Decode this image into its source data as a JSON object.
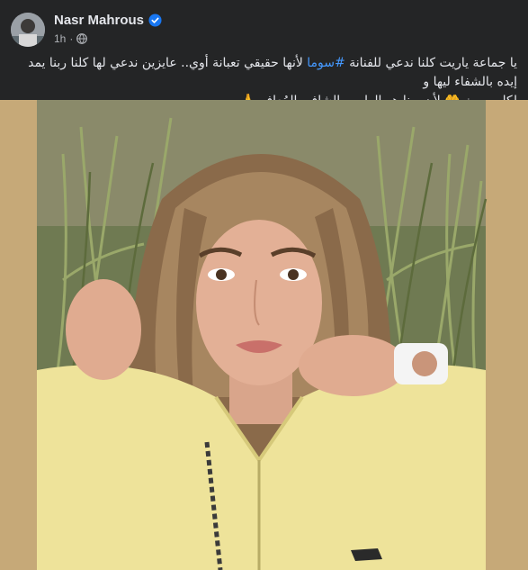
{
  "post": {
    "author": {
      "name": "Nasr Mahrous",
      "verified": true
    },
    "time": "1h",
    "privacy_icon": "globe-icon",
    "text": {
      "line1_prefix": "يا جماعة ياريت كلنا ندعي للفنانة ",
      "hashtag": "#سوما",
      "line1_suffix": " لأنها حقيقي تعبانة أوي.. عايزين ندعي لها كلنا ربنا يمد إيده بالشفاء ليها و",
      "line2": "لكل مريض🤲 لأن ربنا هو الطبيب الشافي المُعافي🙏"
    },
    "media": {
      "icon": "photo",
      "frame_color": "#c6a978"
    }
  },
  "colors": {
    "background": "#242526",
    "text": "#e4e6eb",
    "secondary": "#b0b3b8",
    "link": "#4599ff",
    "verified": "#1877f2"
  }
}
